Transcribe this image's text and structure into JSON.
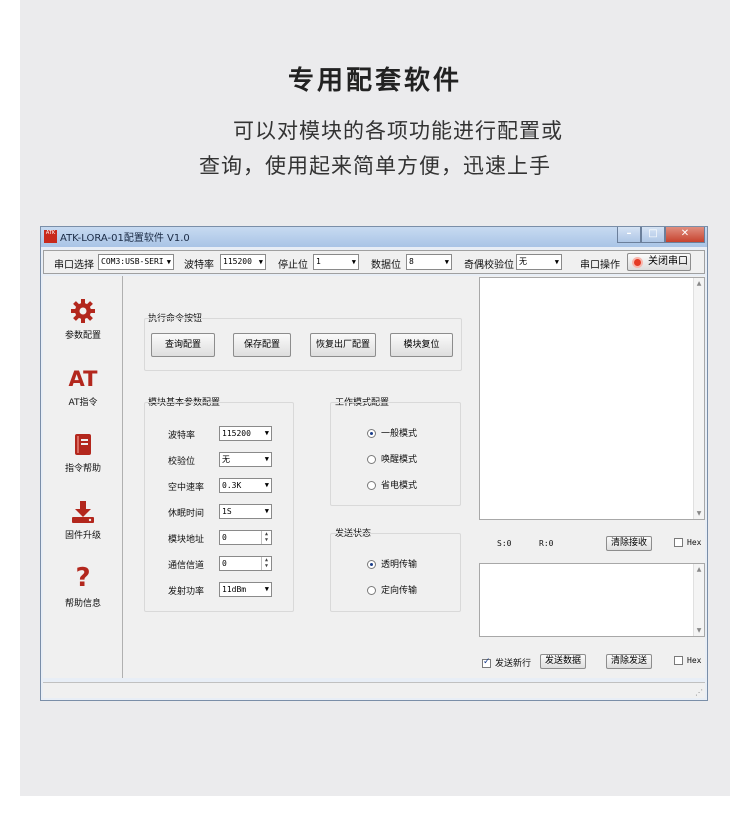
{
  "header": {
    "title": "专用配套软件",
    "subtitle_line1": "可以对模块的各项功能进行配置或",
    "subtitle_line2": "查询，使用起来简单方便，迅速上手"
  },
  "window": {
    "logo_text": "ATK",
    "title": "ATK-LORA-01配置软件 V1.0"
  },
  "toolbar": {
    "port_label": "串口选择",
    "port_value": "COM3:USB-SERI",
    "baud_label": "波特率",
    "baud_value": "115200",
    "stopbits_label": "停止位",
    "stopbits_value": "1",
    "databits_label": "数据位",
    "databits_value": "8",
    "parity_label": "奇偶校验位",
    "parity_value": "无",
    "port_op_label": "串口操作",
    "close_port_label": "关闭串口"
  },
  "sidebar": {
    "items": [
      {
        "label": "参数配置"
      },
      {
        "label": "AT指令",
        "icon_text": "AT"
      },
      {
        "label": "指令帮助"
      },
      {
        "label": "固件升级"
      },
      {
        "label": "帮助信息",
        "icon_text": "?"
      }
    ]
  },
  "commands": {
    "title": "执行命令按钮",
    "buttons": [
      "查询配置",
      "保存配置",
      "恢复出厂配置",
      "模块复位"
    ]
  },
  "params": {
    "title": "模块基本参数配置",
    "rows": [
      {
        "label": "波特率",
        "value": "115200"
      },
      {
        "label": "校验位",
        "value": "无"
      },
      {
        "label": "空中速率",
        "value": "0.3K"
      },
      {
        "label": "休眠时间",
        "value": "1S"
      },
      {
        "label": "模块地址",
        "value": "0"
      },
      {
        "label": "通信信道",
        "value": "0"
      },
      {
        "label": "发射功率",
        "value": "11dBm"
      }
    ]
  },
  "workmode": {
    "title": "工作模式配置",
    "options": [
      "一般模式",
      "唤醒模式",
      "省电模式"
    ],
    "selected": "一般模式"
  },
  "sendstate": {
    "title": "发送状态",
    "options": [
      "透明传输",
      "定向传输"
    ],
    "selected": "透明传输"
  },
  "receive": {
    "s_count": "S:0",
    "r_count": "R:0",
    "clear_button": "清除接收",
    "hex_label": "Hex"
  },
  "send": {
    "newline_label": "发送新行",
    "send_button": "发送数据",
    "clear_button": "清除发送",
    "hex_label": "Hex"
  }
}
